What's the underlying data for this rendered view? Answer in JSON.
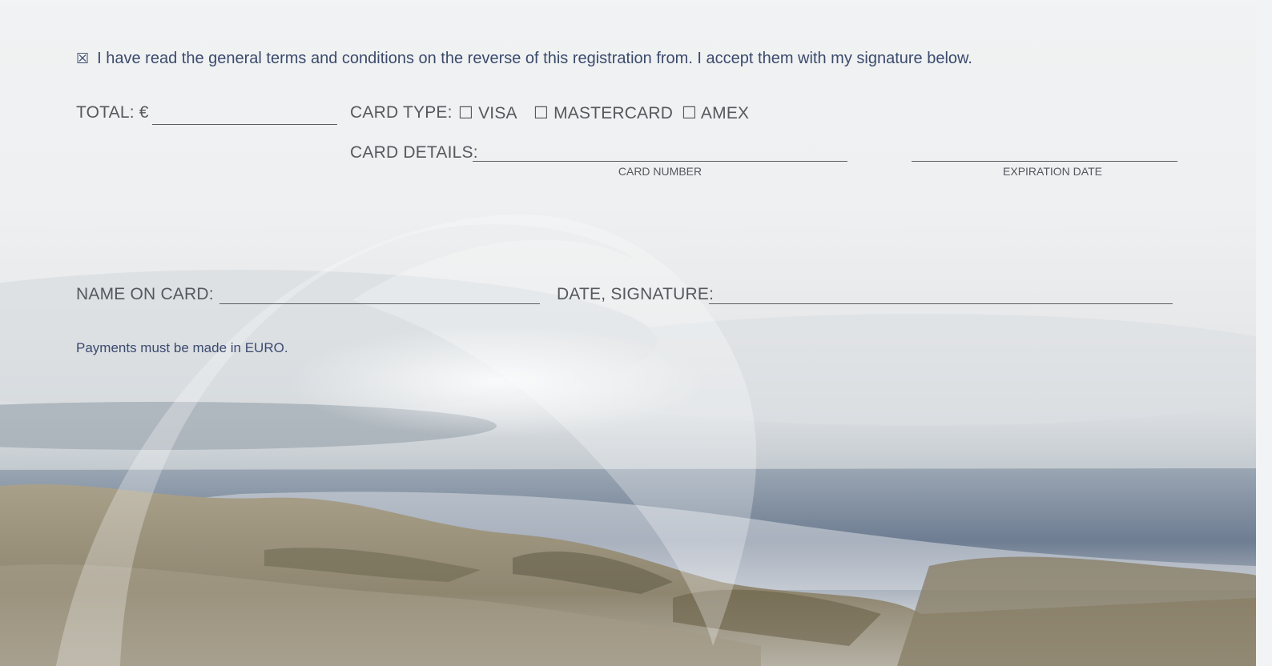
{
  "terms": {
    "checkbox_glyph": "☒",
    "text": "I have read the general terms and conditions on the reverse of this registration from. I accept them with my signature below."
  },
  "total": {
    "label": "TOTAL: €"
  },
  "card_type": {
    "label": "CARD TYPE:",
    "options": [
      {
        "glyph": "☐",
        "label": "VISA"
      },
      {
        "glyph": "☐",
        "label": "MASTERCARD"
      },
      {
        "glyph": "☐",
        "label": "AMEX"
      }
    ]
  },
  "card_details": {
    "label": "CARD DETAILS:",
    "number_caption": "CARD NUMBER",
    "expiration_caption": "EXPIRATION DATE"
  },
  "name_on_card": {
    "label": "NAME ON CARD:"
  },
  "date_signature": {
    "label": "DATE, SIGNATURE:"
  },
  "note": "Payments must be made in EURO.",
  "colors": {
    "navy_text": "#3b4a6e",
    "gray_text": "#55595e"
  }
}
